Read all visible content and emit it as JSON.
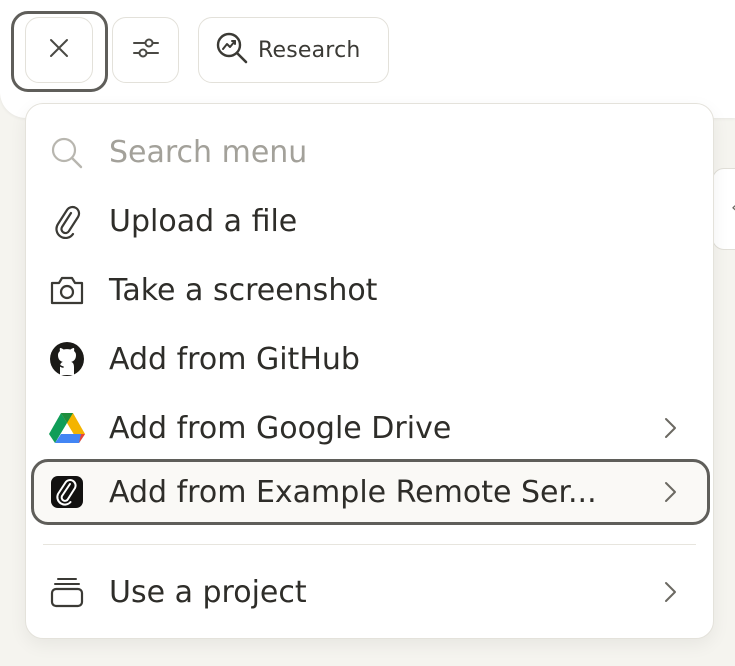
{
  "toolbar": {
    "close_icon": "x-icon",
    "options_icon": "sliders-icon",
    "research_label": "Research",
    "research_icon": "magnifier-trend-icon"
  },
  "menu": {
    "search": {
      "placeholder": "Search menu",
      "icon": "search-icon"
    },
    "items": [
      {
        "label": "Upload a file",
        "icon": "paperclip-icon",
        "submenu": false
      },
      {
        "label": "Take a screenshot",
        "icon": "camera-icon",
        "submenu": false
      },
      {
        "label": "Add from GitHub",
        "icon": "github-icon",
        "submenu": false
      },
      {
        "label": "Add from Google Drive",
        "icon": "google-drive-icon",
        "submenu": true
      },
      {
        "label": "Add from Example Remote Ser...",
        "icon": "remote-server-icon",
        "submenu": true,
        "selected": true
      },
      {
        "label": "Use a project",
        "icon": "project-stack-icon",
        "submenu": true
      }
    ]
  },
  "colors": {
    "background": "#f5f4ef",
    "surface": "#ffffff",
    "text": "#2e2d29",
    "muted": "#a3a19a",
    "focus_ring": "#5f5e5a",
    "drive_green": "#0f9d58",
    "drive_yellow": "#f4b400",
    "drive_blue": "#4285f4"
  }
}
